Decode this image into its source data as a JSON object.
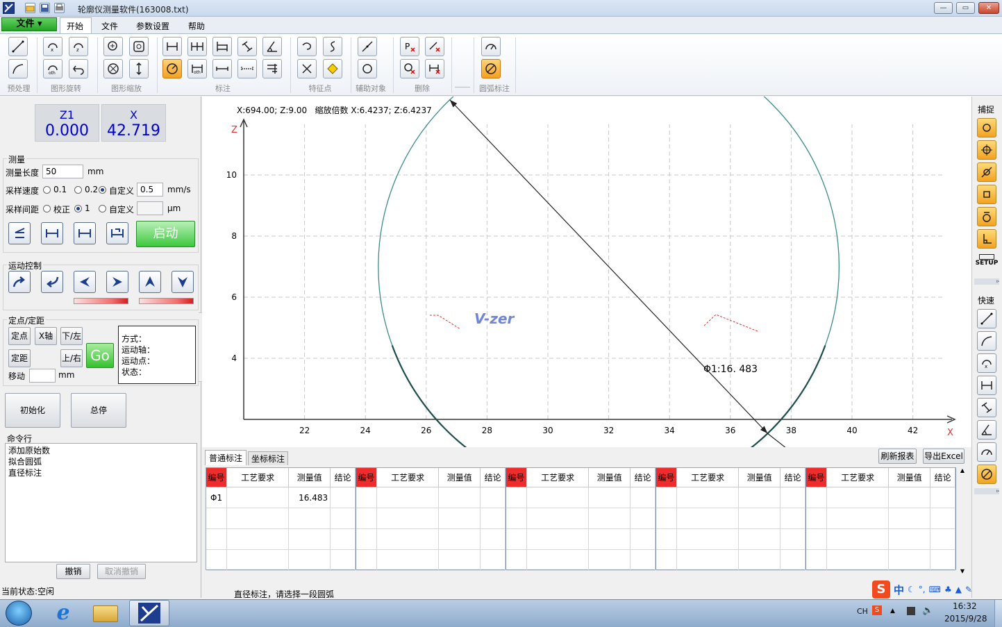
{
  "window": {
    "title": "轮廓仪测量软件(163008.txt)",
    "minimize": "—",
    "maximize": "▭",
    "close": "✕"
  },
  "menu": {
    "file_button": "文件",
    "tabs": [
      "开始",
      "文件",
      "参数设置",
      "帮助"
    ]
  },
  "ribbon": {
    "groups": [
      "预处理",
      "图形旋转",
      "图形缩放",
      "标注",
      "特征点",
      "辅助对象",
      "删除",
      "圆弧标注"
    ]
  },
  "coords": {
    "z1_label": "Z1",
    "z1_value": "0.000",
    "x_label": "X",
    "x_value": "42.719"
  },
  "measure": {
    "title": "测量",
    "length_label": "测量长度",
    "length_value": "50",
    "length_unit": "mm",
    "speed_label": "采样速度",
    "speed_opt1": "0.1",
    "speed_opt2": "0.2",
    "speed_custom": "自定义",
    "speed_value": "0.5",
    "speed_unit": "mm/s",
    "interval_label": "采样间距",
    "interval_opt1": "校正",
    "interval_opt2": "1",
    "interval_custom": "自定义",
    "interval_value": "",
    "interval_unit": "μm",
    "start_button": "启动"
  },
  "motion": {
    "title": "运动控制"
  },
  "positioning": {
    "title": "定点/定距",
    "btn_point": "定点",
    "btn_xaxis": "X轴",
    "btn_downleft": "下/左",
    "btn_distance": "定距",
    "btn_upright": "上/右",
    "btn_go": "Go",
    "move_label": "移动",
    "move_value": "",
    "move_unit": "mm",
    "info_mode": "方式：",
    "info_axis": "运动轴：",
    "info_point": "运动点：",
    "info_state": "状态："
  },
  "actions": {
    "init_button": "初始化",
    "stop_button": "总停"
  },
  "command": {
    "title": "命令行",
    "lines": [
      "添加原始数",
      "拟合圆弧",
      "直径标注"
    ],
    "undo_button": "撤销",
    "redo_button": "取消撤销"
  },
  "status": {
    "current": "当前状态:空闲",
    "hint": "直径标注，请选择一段圆弧"
  },
  "plot": {
    "readout": "X:694.00; Z:9.00   缩放倍数 X:6.4237; Z:6.4237",
    "watermark": "V-zer",
    "dimension_label": "Φ1:16. 483",
    "x_axis_label": "X",
    "z_axis_label": "Z",
    "x_ticks": [
      "22",
      "24",
      "26",
      "28",
      "30",
      "32",
      "34",
      "36",
      "38",
      "40",
      "42"
    ],
    "z_ticks": [
      "10",
      "8",
      "6",
      "4"
    ],
    "circle": {
      "center_x": 32.0,
      "center_z": 7.0,
      "diameter": 16.483
    }
  },
  "bottom": {
    "tab_normal": "普通标注",
    "tab_coord": "坐标标注",
    "refresh_button": "刷新报表",
    "export_button": "导出Excel",
    "columns": [
      "编号",
      "工艺要求",
      "测量值",
      "结论"
    ],
    "rows": [
      {
        "id": "Φ1",
        "requirement": "",
        "value": "16.483",
        "result": ""
      }
    ]
  },
  "rightbar": {
    "snap_label": "捕捉",
    "setup_label": "SETUP",
    "quick_label": "快速"
  },
  "taskbar": {
    "lang": "CH",
    "time": "16:32",
    "date": "2015/9/28",
    "ime": "中"
  },
  "colors": {
    "accent_orange": "#f3a21f",
    "start_green": "#3cc83c",
    "header_red": "#ef2c2c",
    "circle_teal": "#3c8c8c",
    "value_blue": "#0000cc"
  }
}
